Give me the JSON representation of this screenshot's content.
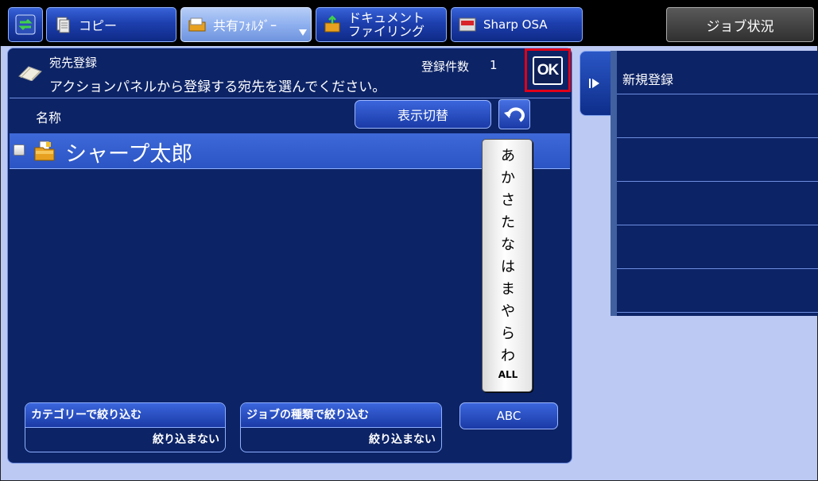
{
  "topbar": {
    "buttons": [
      {
        "label": "コピー"
      },
      {
        "label": "共有ﾌｫﾙﾀﾞｰ"
      },
      {
        "label_line1": "ドキュメント",
        "label_line2": "ファイリング"
      },
      {
        "label": "Sharp OSA"
      }
    ],
    "job_status": "ジョブ状況"
  },
  "header": {
    "title": "宛先登録",
    "instruction": "アクションパネルから登録する宛先を選んでください。",
    "count_label": "登録件数",
    "count_value": "1",
    "ok_label": "OK"
  },
  "list": {
    "column_name": "名称",
    "switch_label": "表示切替",
    "rows": [
      {
        "name": "シャープ太郎",
        "selected": true
      }
    ]
  },
  "kana_index": [
    "あ",
    "か",
    "さ",
    "た",
    "な",
    "は",
    "ま",
    "や",
    "ら",
    "わ"
  ],
  "kana_all": "ALL",
  "filters": [
    {
      "title": "カテゴリーで絞り込む",
      "value": "絞り込まない"
    },
    {
      "title": "ジョブの種類で絞り込む",
      "value": "絞り込まない"
    }
  ],
  "abc_label": "ABC",
  "action_panel": {
    "items": [
      "新規登録"
    ]
  },
  "colors": {
    "panel_bg": "#0c2366",
    "topbar_bg": "#000000",
    "page_bg": "#bcc9f2",
    "highlight_border": "#e00018"
  }
}
